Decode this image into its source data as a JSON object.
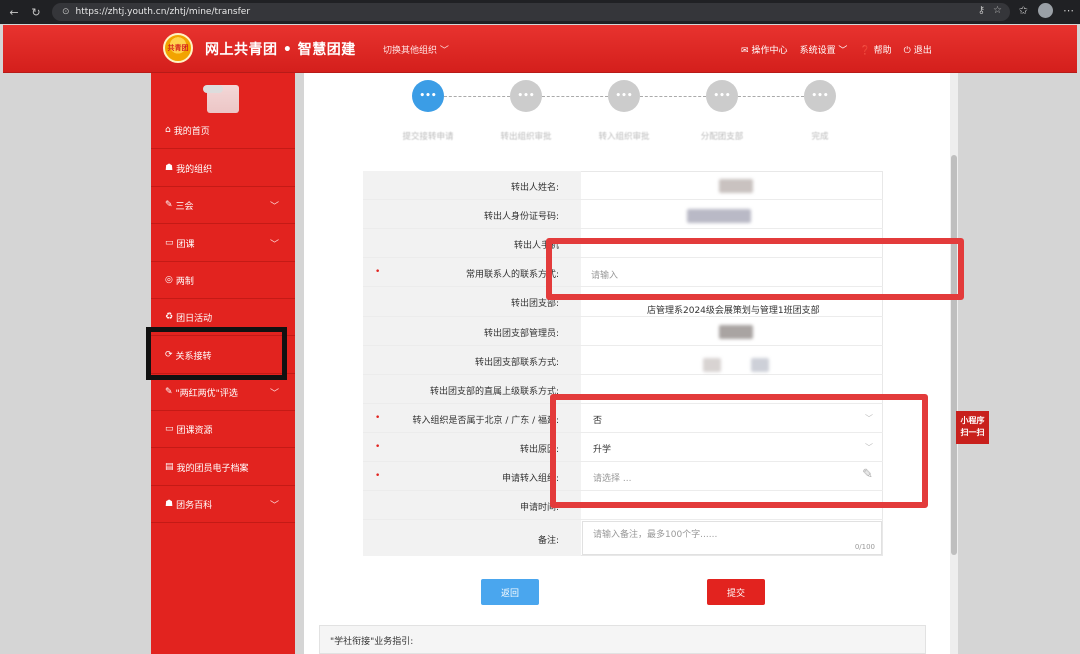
{
  "browser": {
    "url": "https://zhtj.youth.cn/zhtj/mine/transfer"
  },
  "header": {
    "logo_text": "共青团",
    "title": "网上共青团 • 智慧团建",
    "org_switch": "切换其他组织 ﹀",
    "ops_center": "操作中心",
    "settings": "系统设置 ﹀",
    "help": "帮助",
    "logout": "退出"
  },
  "sidebar": {
    "items": [
      {
        "icon": "home-icon",
        "label": "我的首页"
      },
      {
        "icon": "group-icon",
        "label": "我的组织"
      },
      {
        "icon": "edit-icon",
        "label": "三会"
      },
      {
        "icon": "folder-icon",
        "label": "团课"
      },
      {
        "icon": "target-icon",
        "label": "两制"
      },
      {
        "icon": "recycle-icon",
        "label": "团日活动"
      },
      {
        "icon": "refresh-icon",
        "label": "关系接转"
      },
      {
        "icon": "edit-icon",
        "label": "\"两红两优\"评选"
      },
      {
        "icon": "folder-icon",
        "label": "团课资源"
      },
      {
        "icon": "file-icon",
        "label": "我的团员电子档案"
      },
      {
        "icon": "group-icon",
        "label": "团务百科"
      }
    ]
  },
  "steps": [
    {
      "label": "提交接转申请",
      "icon_text": "•••"
    },
    {
      "label": "转出组织审批",
      "icon_text": "•••"
    },
    {
      "label": "转入组织审批",
      "icon_text": "•••"
    },
    {
      "label": "分配团支部",
      "icon_text": "•••"
    },
    {
      "label": "完成",
      "icon_text": "•••"
    }
  ],
  "form": {
    "name_label": "转出人姓名:",
    "id_label": "转出人身份证号码:",
    "phone_label": "转出人手机",
    "contact_label": "常用联系人的联系方式:",
    "contact_placeholder": "请输入",
    "branch_label": "转出团支部:",
    "branch_value": "店管理系2024级会展策划与管理1班团支部",
    "manager_label": "转出团支部管理员:",
    "branch_contact_label": "转出团支部联系方式:",
    "superior_label": "转出团支部的直属上级联系方式:",
    "region_label": "转入组织是否属于北京 / 广东 / 福建:",
    "region_value": "否",
    "reason_label": "转出原因:",
    "reason_value": "升学",
    "target_label": "申请转入组织:",
    "target_placeholder": "请选择 ...",
    "apply_label": "申请时间:",
    "remark_label": "备注:",
    "remark_placeholder": "请输入备注，最多100个字......",
    "remark_count": "0/100"
  },
  "buttons": {
    "back": "返回",
    "submit": "提交"
  },
  "guide": {
    "title": "\"学社衔接\"业务指引:"
  },
  "mini_program": {
    "line1": "小程序",
    "line2": "扫一扫"
  }
}
